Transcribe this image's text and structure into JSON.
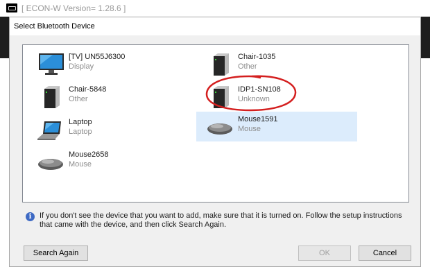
{
  "app": {
    "title": "[ ECON-W Version= 1.28.6 ]"
  },
  "dialog": {
    "title": "Select Bluetooth Device",
    "devices": [
      {
        "name": "[TV] UN55J6300",
        "type": "Display",
        "icon": "monitor-icon",
        "selected": false
      },
      {
        "name": "Chair-1035",
        "type": "Other",
        "icon": "computer-tower-icon",
        "selected": false
      },
      {
        "name": "Chair-5848",
        "type": "Other",
        "icon": "computer-tower-icon",
        "selected": false
      },
      {
        "name": "IDP1-SN108",
        "type": "Unknown",
        "icon": "computer-tower-icon",
        "selected": false
      },
      {
        "name": "Laptop",
        "type": "Laptop",
        "icon": "laptop-icon",
        "selected": false
      },
      {
        "name": "Mouse1591",
        "type": "Mouse",
        "icon": "mouse-icon",
        "selected": true
      },
      {
        "name": "Mouse2658",
        "type": "Mouse",
        "icon": "mouse-icon",
        "selected": false
      }
    ],
    "highlight_color": "#d41f1f",
    "selection_color": "#dcecfc",
    "info_text": "If you don't see the device that you want to add, make sure that it is turned on. Follow the setup instructions that came with the device, and then click Search Again.",
    "buttons": {
      "search_again": "Search Again",
      "ok": "OK",
      "cancel": "Cancel"
    }
  }
}
